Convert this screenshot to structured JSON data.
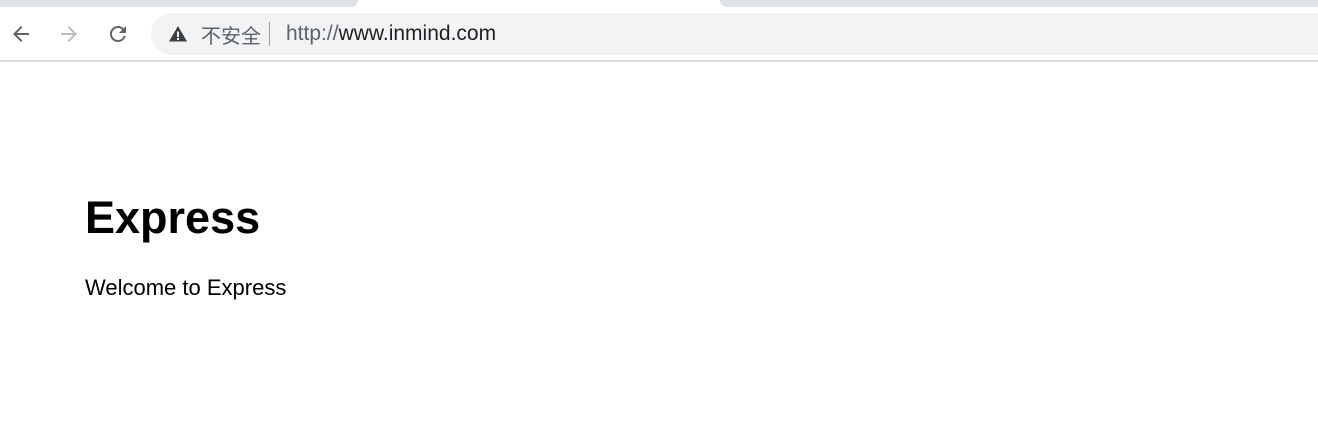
{
  "browser": {
    "security_label": "不安全",
    "url_scheme": "http://",
    "url_host": "www.inmind.com"
  },
  "page": {
    "heading": "Express",
    "paragraph": "Welcome to Express"
  },
  "icons": {
    "back": "back-arrow-icon",
    "forward": "forward-arrow-icon",
    "reload": "reload-icon",
    "security": "warning-triangle-icon"
  },
  "colors": {
    "omnibox_bg": "#f1f3f4",
    "tab_inactive": "#dee1e6",
    "icon_active": "#5f6368",
    "icon_disabled": "#babcbe"
  }
}
